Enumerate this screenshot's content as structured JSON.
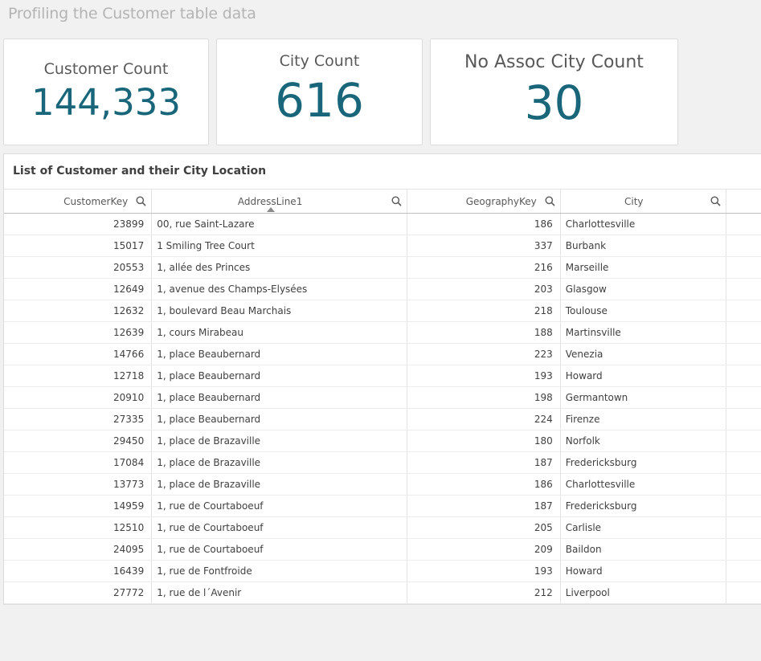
{
  "sheet": {
    "title": "Profiling the Customer table data"
  },
  "kpis": [
    {
      "label": "Customer Count",
      "value": "144,333"
    },
    {
      "label": "City Count",
      "value": "616"
    },
    {
      "label": "No Assoc City Count",
      "value": "30"
    }
  ],
  "colors": {
    "kpi_value": "#19667a",
    "title": "#b4b4b4",
    "background": "#f1f1f1"
  },
  "table": {
    "title": "List of Customer and their City Location",
    "columns": [
      "CustomerKey",
      "AddressLine1",
      "GeographyKey",
      "City"
    ],
    "sorted_column": "AddressLine1",
    "rows": [
      [
        "23899",
        "00, rue Saint-Lazare",
        "186",
        "Charlottesville"
      ],
      [
        "15017",
        "1 Smiling Tree Court",
        "337",
        "Burbank"
      ],
      [
        "20553",
        "1, allée des Princes",
        "216",
        "Marseille"
      ],
      [
        "12649",
        "1, avenue des Champs-Elysées",
        "203",
        "Glasgow"
      ],
      [
        "12632",
        "1, boulevard Beau Marchais",
        "218",
        "Toulouse"
      ],
      [
        "12639",
        "1, cours Mirabeau",
        "188",
        "Martinsville"
      ],
      [
        "14766",
        "1, place Beaubernard",
        "223",
        "Venezia"
      ],
      [
        "12718",
        "1, place Beaubernard",
        "193",
        "Howard"
      ],
      [
        "20910",
        "1, place Beaubernard",
        "198",
        "Germantown"
      ],
      [
        "27335",
        "1, place Beaubernard",
        "224",
        "Firenze"
      ],
      [
        "29450",
        "1, place de Brazaville",
        "180",
        "Norfolk"
      ],
      [
        "17084",
        "1, place de Brazaville",
        "187",
        "Fredericksburg"
      ],
      [
        "13773",
        "1, place de Brazaville",
        "186",
        "Charlottesville"
      ],
      [
        "14959",
        "1, rue de Courtaboeuf",
        "187",
        "Fredericksburg"
      ],
      [
        "12510",
        "1, rue de Courtaboeuf",
        "205",
        "Carlisle"
      ],
      [
        "24095",
        "1, rue de Courtaboeuf",
        "209",
        "Baildon"
      ],
      [
        "16439",
        "1, rue de Fontfroide",
        "193",
        "Howard"
      ],
      [
        "27772",
        "1, rue de l´Avenir",
        "212",
        "Liverpool"
      ]
    ]
  }
}
